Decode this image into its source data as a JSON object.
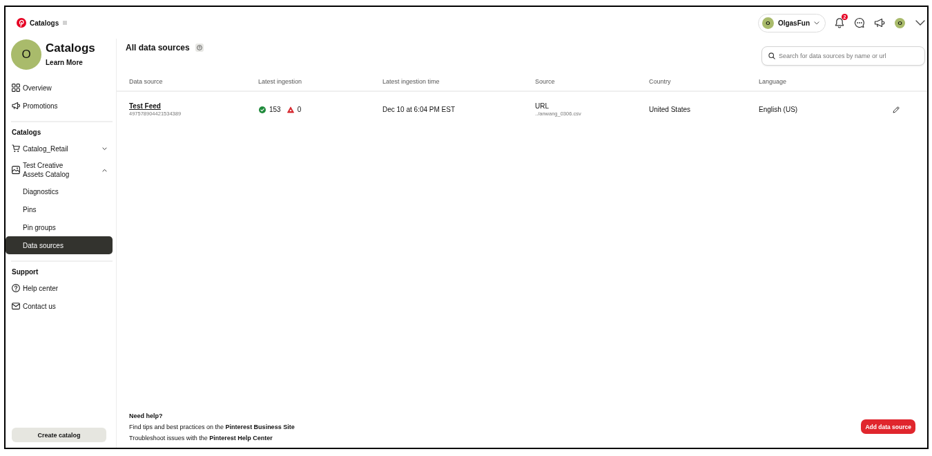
{
  "header": {
    "app_title": "Catalogs",
    "account": {
      "avatar_letter": "O",
      "name": "OlgasFun"
    },
    "notifications": {
      "count": "2"
    },
    "profile": {
      "avatar_letter": "O"
    }
  },
  "sidebar": {
    "profile": {
      "avatar_letter": "O",
      "title": "Catalogs",
      "link": "Learn More"
    },
    "items": [
      {
        "label": "Overview",
        "selected": false
      },
      {
        "label": "Promotions",
        "selected": false
      }
    ],
    "sections": [
      {
        "title": "Catalogs",
        "items": [
          {
            "label": "Catalog_Retail",
            "selected": false,
            "expanded": false
          },
          {
            "label": "Test Creative Assets Catalog",
            "selected": false,
            "expanded": true,
            "children": [
              {
                "label": "Diagnostics",
                "selected": false
              },
              {
                "label": "Pins",
                "selected": false
              },
              {
                "label": "Pin groups",
                "selected": false
              },
              {
                "label": "Data sources",
                "selected": true
              }
            ]
          }
        ]
      },
      {
        "title": "Support",
        "items": [
          {
            "label": "Help center",
            "selected": false
          },
          {
            "label": "Contact us",
            "selected": false
          }
        ]
      }
    ],
    "create_button": "Create catalog"
  },
  "main": {
    "title": "All data sources",
    "search": {
      "placeholder": "Search for data sources by name or url"
    },
    "table": {
      "columns": [
        "Data source",
        "Latest ingestion",
        "Latest ingestion time",
        "Source",
        "Country",
        "Language"
      ],
      "rows": [
        {
          "name": "Test Feed",
          "id": "497578904421534389",
          "success_count": "153",
          "error_count": "0",
          "time": "Dec 10 at 6:04 PM EST",
          "source_type": "URL",
          "source_path": "../anwang_0306.csv",
          "country": "United States",
          "language": "English (US)"
        }
      ]
    },
    "help": {
      "title": "Need help?",
      "lines": [
        {
          "text": "Find tips and best practices on the",
          "link": "Pinterest Business Site"
        },
        {
          "text": "Troubleshoot issues with the",
          "link": "Pinterest Help Center"
        }
      ]
    },
    "add_button": "Add data source"
  }
}
